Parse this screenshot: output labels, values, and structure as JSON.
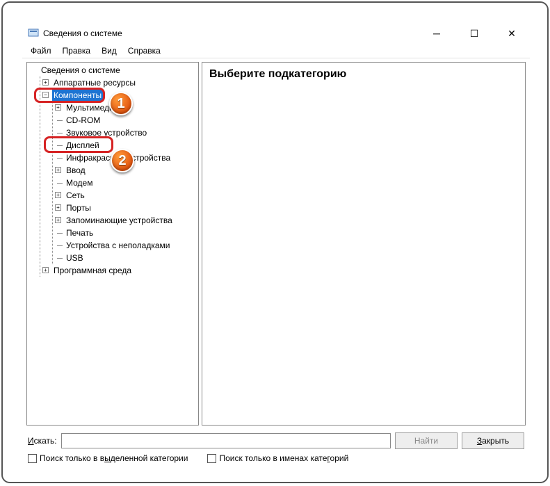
{
  "window": {
    "title": "Сведения о системе"
  },
  "menu": {
    "file": "Файл",
    "edit": "Правка",
    "view": "Вид",
    "help": "Справка"
  },
  "tree": {
    "root": "Сведения о системе",
    "hw_resources": "Аппаратные ресурсы",
    "components": "Компоненты",
    "multimedia": "Мультимедиа",
    "cdrom": "CD-ROM",
    "sound": "Звуковое устройство",
    "display": "Дисплей",
    "infrared": "Инфракрасные устройства",
    "input": "Ввод",
    "modem": "Модем",
    "network": "Сеть",
    "ports": "Порты",
    "storage": "Запоминающие устройства",
    "printing": "Печать",
    "problem_devices": "Устройства с неполадками",
    "usb": "USB",
    "software_env": "Программная среда"
  },
  "main": {
    "heading": "Выберите подкатегорию"
  },
  "search": {
    "label": "Искать:",
    "value": "",
    "find_btn": "Найти",
    "close_btn": "Закрыть",
    "chk_selected_html": "Поиск только в в<u>ы</u>деленной категории",
    "chk_names_html": "Поиск только в именах кате<u>г</u>орий"
  },
  "badges": {
    "one": "1",
    "two": "2"
  }
}
